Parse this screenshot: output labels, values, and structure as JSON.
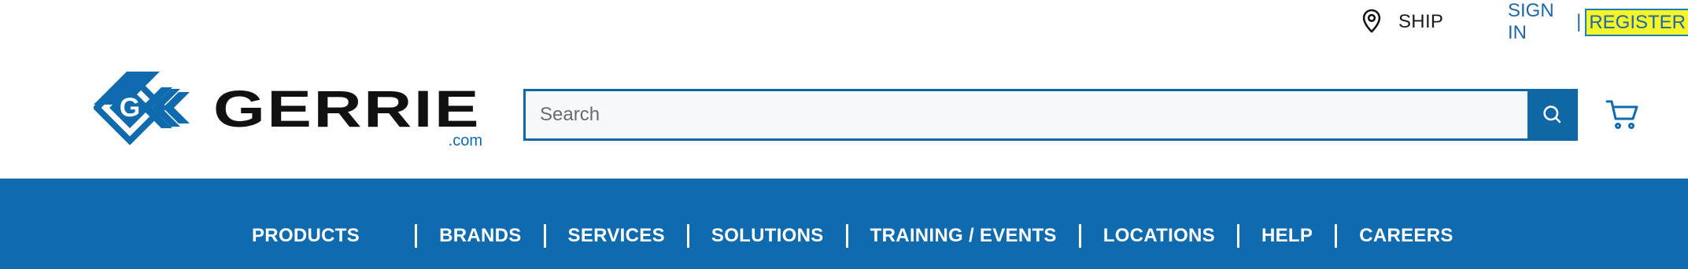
{
  "util": {
    "ship_label": "SHIP",
    "ship_icon": "map-pin-icon",
    "signin_label": "SIGN IN",
    "separator": "|",
    "register_label": "REGISTER"
  },
  "logo": {
    "brand": "GERRIE",
    "suffix": ".com",
    "mark_letter": "G"
  },
  "search": {
    "placeholder": "Search",
    "value": "",
    "button_icon": "search-icon"
  },
  "cart": {
    "icon": "cart-icon"
  },
  "nav": {
    "items": [
      {
        "label": "PRODUCTS"
      },
      {
        "label": "BRANDS"
      },
      {
        "label": "SERVICES"
      },
      {
        "label": "SOLUTIONS"
      },
      {
        "label": "TRAINING / EVENTS"
      },
      {
        "label": "LOCATIONS"
      },
      {
        "label": "HELP"
      },
      {
        "label": "CAREERS"
      }
    ]
  },
  "colors": {
    "brand_blue": "#0f6bad",
    "link_blue": "#1f67a6",
    "highlight": "#f5f528"
  }
}
